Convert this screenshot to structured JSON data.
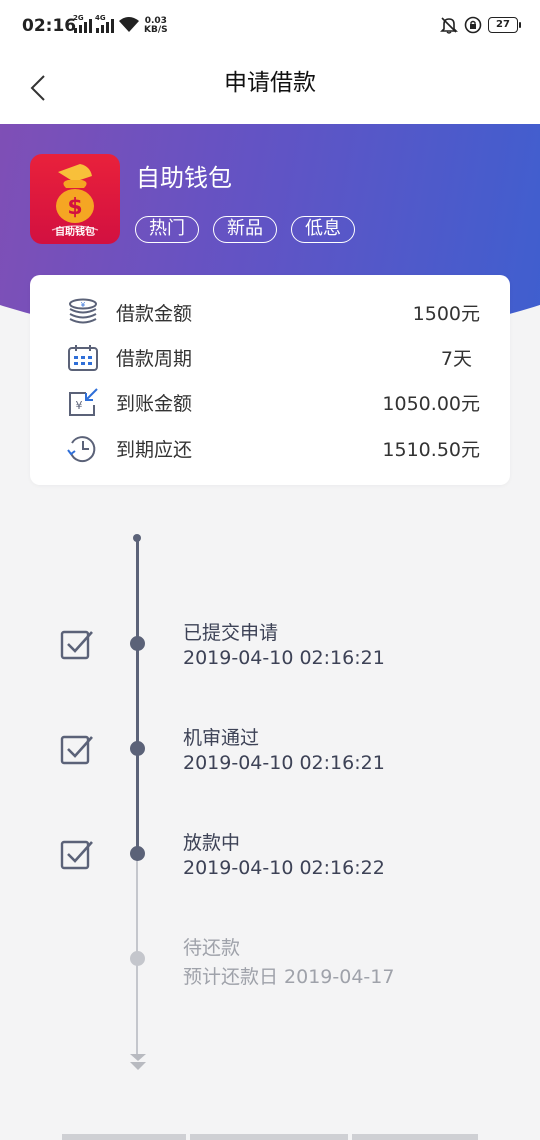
{
  "status_bar": {
    "time": "02:16",
    "net1": "2G",
    "net2": "4G",
    "speed_value": "0.03",
    "speed_unit": "KB/S",
    "battery": "27"
  },
  "nav": {
    "title": "申请借款"
  },
  "product": {
    "name": "自助钱包",
    "icon_caption": "自助钱包",
    "tags": [
      "热门",
      "新品",
      "低息"
    ]
  },
  "loan_info": {
    "rows": [
      {
        "label": "借款金额",
        "value": "1500元",
        "icon": "coins-icon"
      },
      {
        "label": "借款周期",
        "value": "7天",
        "icon": "calendar-icon"
      },
      {
        "label": "到账金额",
        "value": "1050.00元",
        "icon": "yuan-receive-icon"
      },
      {
        "label": "到期应还",
        "value": "1510.50元",
        "icon": "clock-history-icon"
      }
    ]
  },
  "timeline": [
    {
      "title": "已提交申请",
      "time": "2019-04-10 02:16:21",
      "done": true
    },
    {
      "title": "机审通过",
      "time": "2019-04-10 02:16:21",
      "done": true
    },
    {
      "title": "放款中",
      "time": "2019-04-10 02:16:22",
      "done": true
    },
    {
      "title": "待还款",
      "time": "预计还款日 2019-04-17",
      "done": false
    }
  ],
  "colors": {
    "accent_gradient_start": "#7f4fb6",
    "accent_gradient_end": "#3f5fcf",
    "icon_red": "#e9213b",
    "timeline_active": "#5b6278",
    "timeline_pending": "#c4c6cc"
  }
}
